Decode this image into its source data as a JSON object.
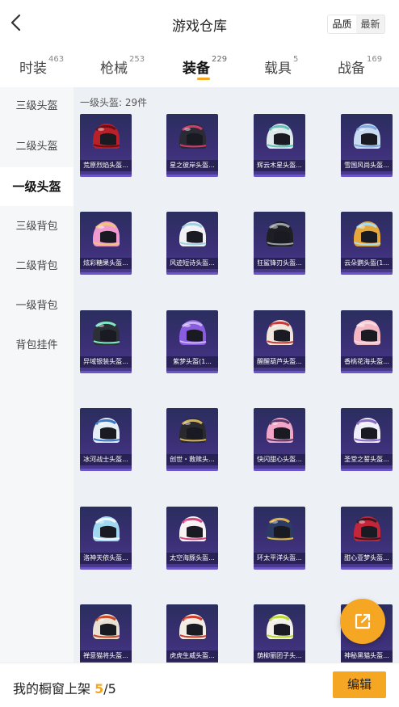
{
  "header": {
    "title": "游戏仓库",
    "sort": {
      "options": [
        "品质",
        "最新"
      ],
      "active": 0
    }
  },
  "tabs": [
    {
      "label": "时装",
      "count": "463"
    },
    {
      "label": "枪械",
      "count": "253"
    },
    {
      "label": "装备",
      "count": "229",
      "active": true
    },
    {
      "label": "载具",
      "count": "5"
    },
    {
      "label": "战备",
      "count": "169"
    }
  ],
  "sidebar": {
    "items": [
      {
        "label": "三级头盔"
      },
      {
        "label": "二级头盔"
      },
      {
        "label": "一级头盔",
        "active": true
      },
      {
        "label": "三级背包"
      },
      {
        "label": "二级背包"
      },
      {
        "label": "一级背包"
      },
      {
        "label": "背包挂件"
      }
    ]
  },
  "content": {
    "count_label": "一级头盔: 29件",
    "items": [
      {
        "name": "荒原烈焰头盔...",
        "color": "#b8202a",
        "accent": "#6a0f12"
      },
      {
        "name": "星之彼岸头盔...",
        "color": "#2b2b35",
        "accent": "#d23b6b"
      },
      {
        "name": "辉云木星头盔...",
        "color": "#dfe8ea",
        "accent": "#5ec4b8"
      },
      {
        "name": "雪国风尚头盔...",
        "color": "#c9dcf2",
        "accent": "#7fa8dd"
      },
      {
        "name": "炫彩糖果头盔...",
        "color": "#f29ad0",
        "accent": "#f0c27a"
      },
      {
        "name": "风迹短诗头盔...",
        "color": "#f1f1f3",
        "accent": "#9fd0e6"
      },
      {
        "name": "狂鲨锋刃头盔...",
        "color": "#1e1f24",
        "accent": "#9aa0a6"
      },
      {
        "name": "云朵鹦头盔(1...",
        "color": "#e6a83a",
        "accent": "#a9dcef"
      },
      {
        "name": "异域银装头盔...",
        "color": "#2a3033",
        "accent": "#7fe6c9"
      },
      {
        "name": "紫梦头盔(1...",
        "color": "#8a5ce0",
        "accent": "#c7b3f5"
      },
      {
        "name": "醒醒葫芦头盔...",
        "color": "#f1e6dc",
        "accent": "#c63a3a"
      },
      {
        "name": "香桃花海头盔...",
        "color": "#f3b8c4",
        "accent": "#f7d9df"
      },
      {
        "name": "冰河战士头盔...",
        "color": "#e6eef6",
        "accent": "#3a78c8"
      },
      {
        "name": "创世・救赎头...",
        "color": "#2a2a2e",
        "accent": "#d4b35a"
      },
      {
        "name": "快闪甜心头盔...",
        "color": "#f2a6c8",
        "accent": "#5a3a6a"
      },
      {
        "name": "圣堂之誓头盔...",
        "color": "#f0eef6",
        "accent": "#8a6cc8"
      },
      {
        "name": "洛神天依头盔...",
        "color": "#9fd8ef",
        "accent": "#f2f7fb"
      },
      {
        "name": "太空海豚头盔...",
        "color": "#f7f3f5",
        "accent": "#d4477f"
      },
      {
        "name": "环太平洋头盔...",
        "color": "#2b3b64",
        "accent": "#e2b04a"
      },
      {
        "name": "甜心亚梦头盔...",
        "color": "#c3263a",
        "accent": "#3a1a22"
      },
      {
        "name": "禅意猫将头盔...",
        "color": "#e9e1d2",
        "accent": "#c84a2a"
      },
      {
        "name": "虎虎生威头盔...",
        "color": "#f2ece4",
        "accent": "#d23a2a"
      },
      {
        "name": "荫柳丽团子头...",
        "color": "#f4f2e8",
        "accent": "#b8d832"
      },
      {
        "name": "神秘黑猫头盔...",
        "color": "#2a2a2e",
        "accent": "#c93a4a"
      }
    ]
  },
  "fab": {
    "icon": "share-out-icon"
  },
  "bottom": {
    "text_prefix": "我的橱窗上架 ",
    "current": "5",
    "total": "/5",
    "edit_label": "编辑"
  },
  "colors": {
    "accent": "#f5a623",
    "card_bg": "#3b2f76"
  }
}
